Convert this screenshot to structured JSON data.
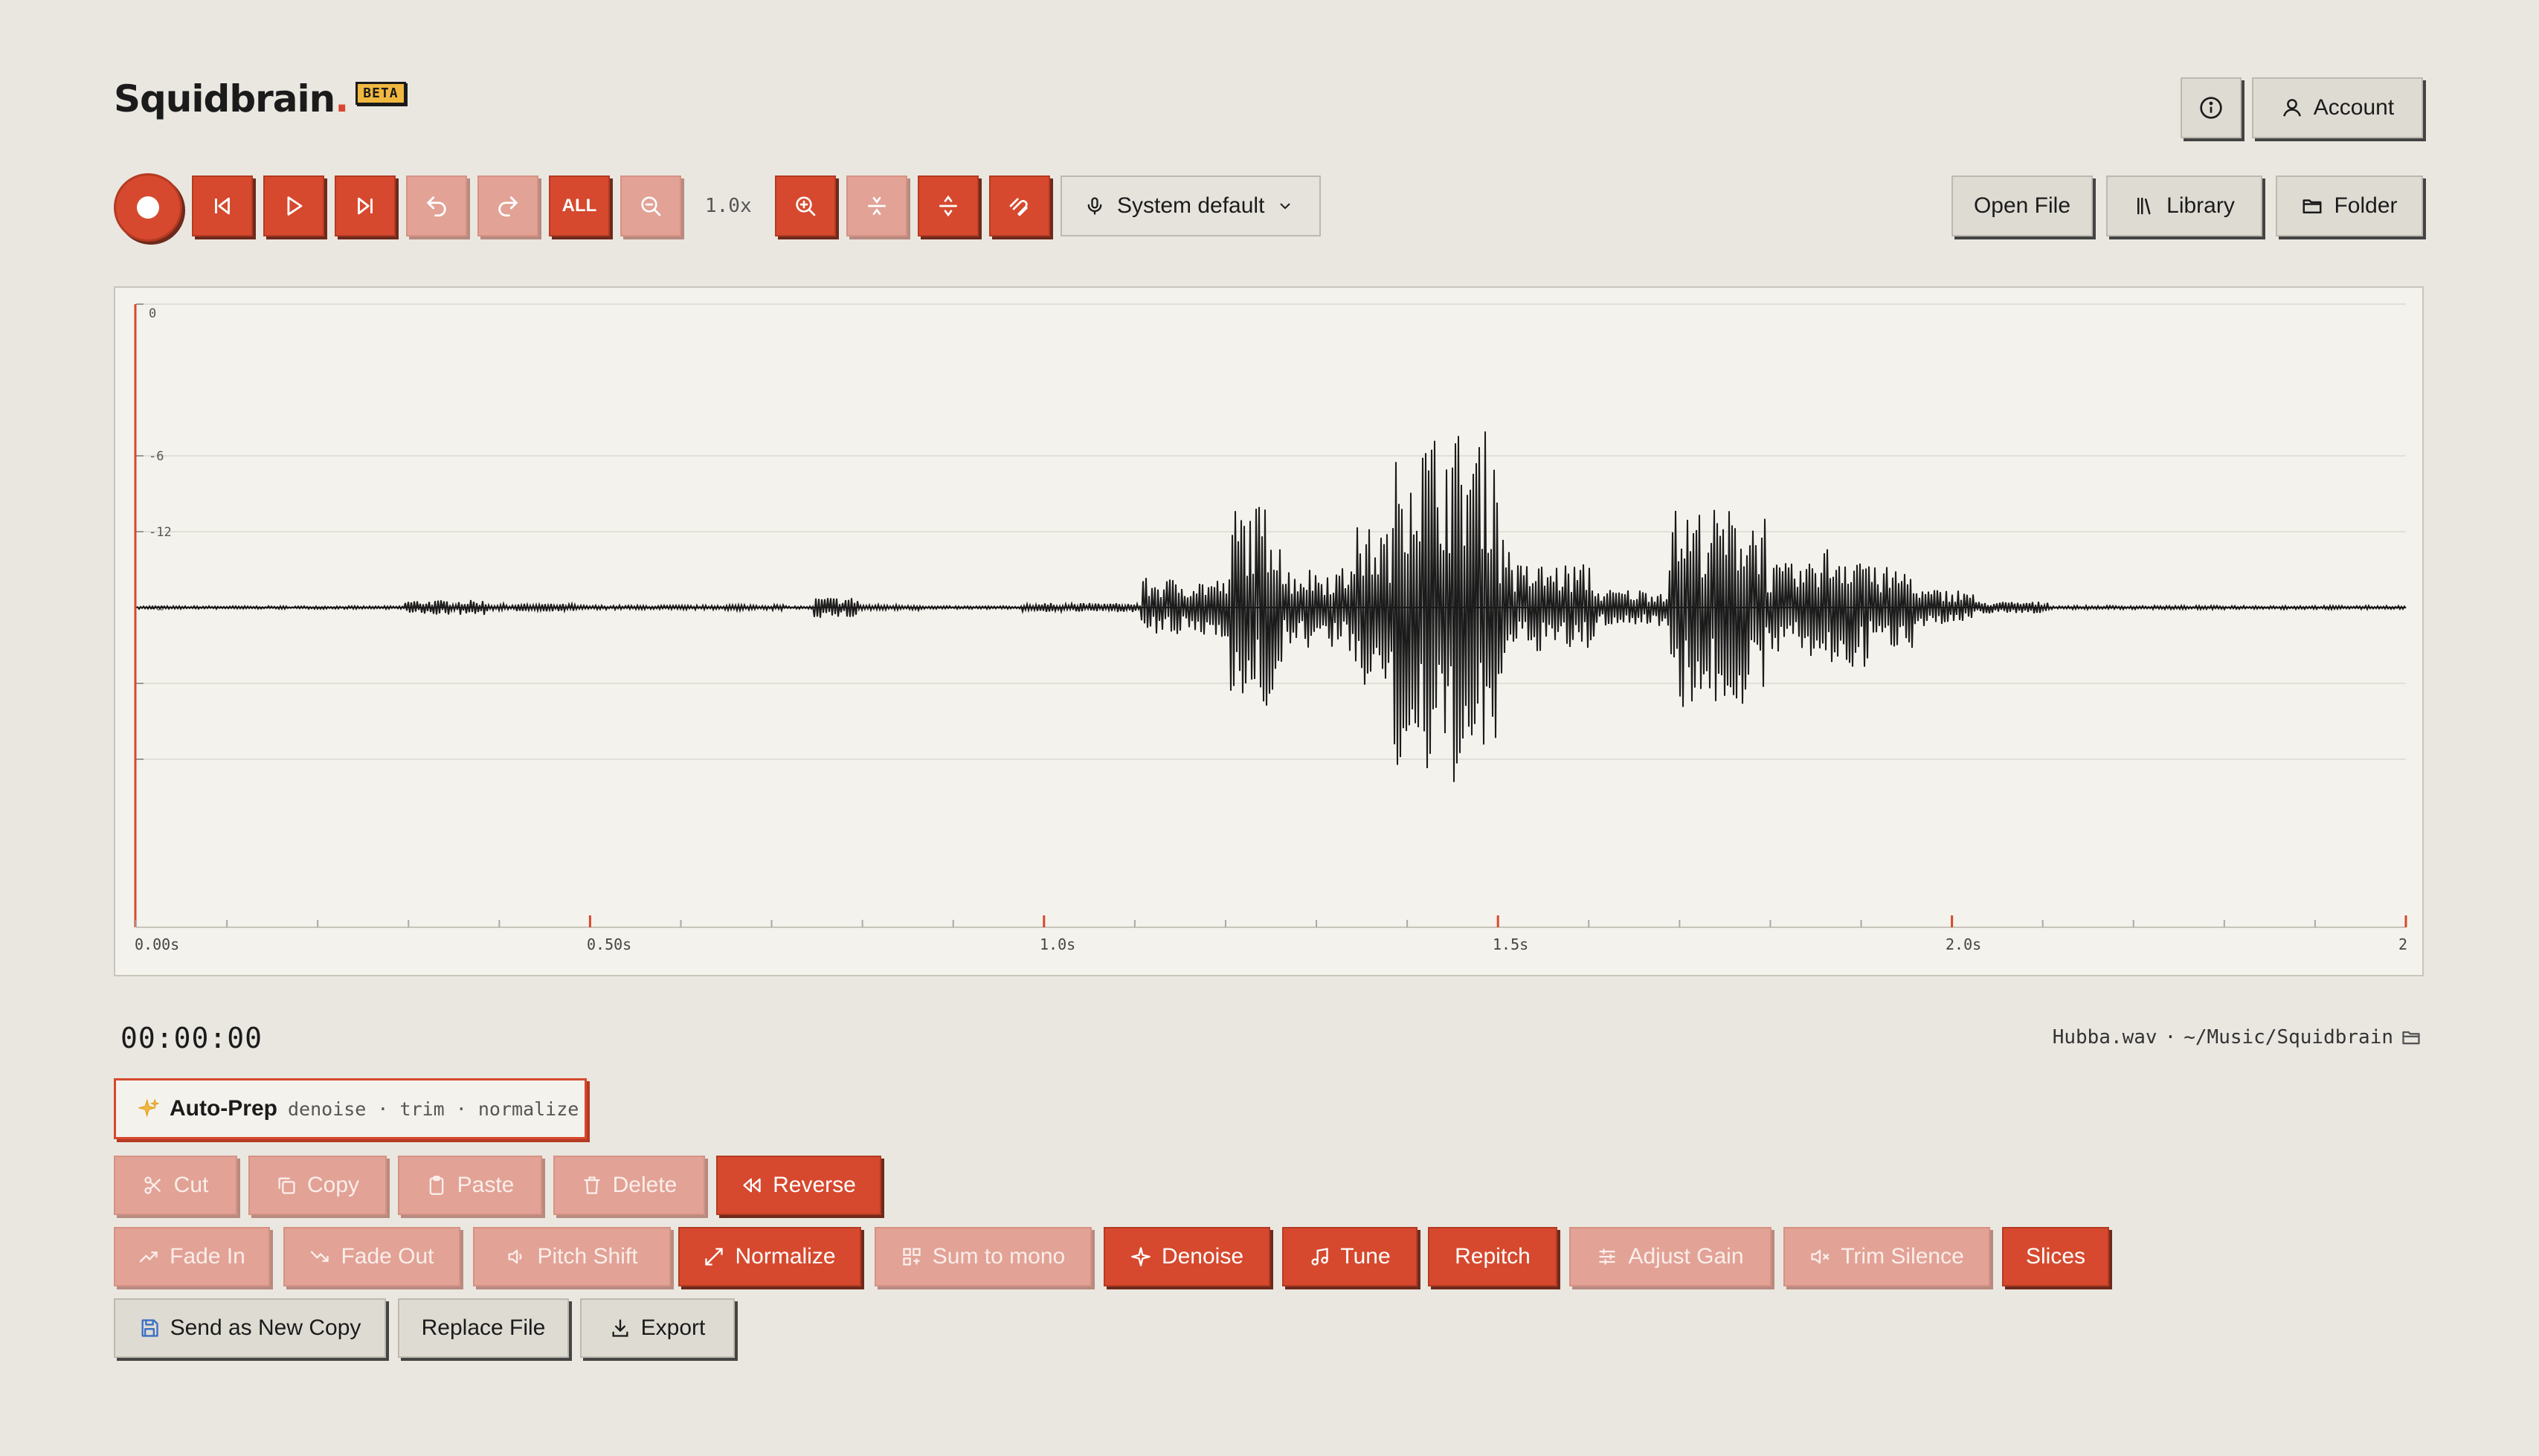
{
  "app": {
    "name": "Squidbrain",
    "beta": "BETA"
  },
  "header": {
    "account_label": "Account"
  },
  "toolbar": {
    "all_label": "ALL",
    "zoom_level": "1.0x",
    "input_device": "System default",
    "open_file": "Open File",
    "library": "Library",
    "folder": "Folder"
  },
  "waveform": {
    "db_labels": [
      "0",
      "-6",
      "-12",
      "-∞"
    ],
    "time_labels": [
      "0.00s",
      "0.50s",
      "1.0s",
      "1.5s",
      "2.0s",
      "2"
    ]
  },
  "status": {
    "time": "00:00:00",
    "file_name": "Hubba.wav",
    "separator": "·",
    "file_path": "~/Music/Squidbrain"
  },
  "autoprep": {
    "label": "Auto-Prep",
    "steps": "denoise · trim · normalize"
  },
  "actions": {
    "cut": "Cut",
    "copy": "Copy",
    "paste": "Paste",
    "delete": "Delete",
    "reverse": "Reverse",
    "fade_in": "Fade In",
    "fade_out": "Fade Out",
    "pitch_shift": "Pitch Shift",
    "normalize": "Normalize",
    "sum_to_mono": "Sum to mono",
    "denoise": "Denoise",
    "tune": "Tune",
    "repitch": "Repitch",
    "adjust_gain": "Adjust Gain",
    "trim_silence": "Trim Silence",
    "slices": "Slices",
    "send_as_new_copy": "Send as New Copy",
    "replace_file": "Replace File",
    "export": "Export"
  },
  "colors": {
    "accent": "#d6492e",
    "disabled": "#e2a296",
    "background": "#e9e7e0",
    "panel": "#f4f2ec",
    "beta": "#f1b840"
  }
}
